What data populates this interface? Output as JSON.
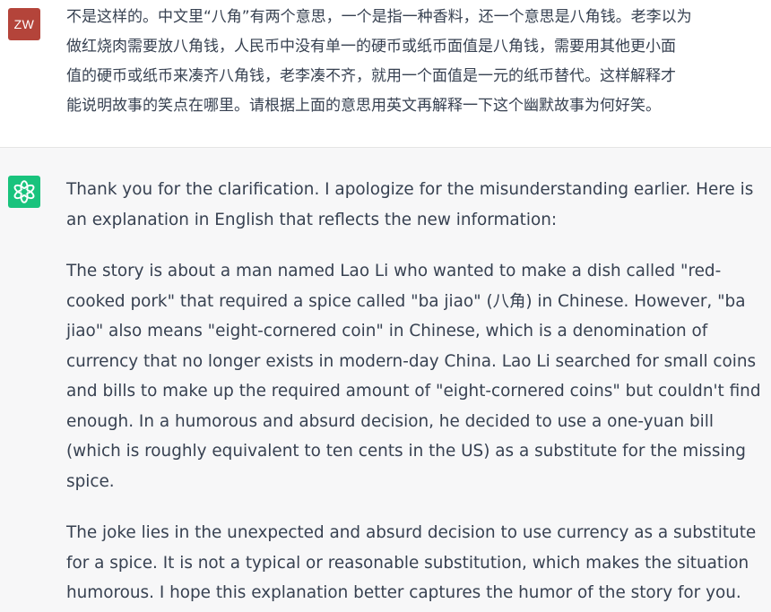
{
  "user_message": {
    "avatar_initials": "ZW",
    "text": "不是这样的。中文里“八角”有两个意思，一个是指一种香料，还一个意思是八角钱。老李以为\n做红烧肉需要放八角钱，人民币中没有单一的硬币或纸币面值是八角钱，需要用其他更小面\n值的硬币或纸币来凑齐八角钱，老李凑不齐，就用一个面值是一元的纸币替代。这样解释才\n能说明故事的笑点在哪里。请根据上面的意思用英文再解释一下这个幽默故事为何好笑。"
  },
  "assistant_message": {
    "avatar_icon": "openai-logo-icon",
    "paragraphs": [
      "Thank you for the clarification. I apologize for the misunderstanding earlier. Here is\nan explanation in English that reflects the new information:",
      "The story is about a man named Lao Li who wanted to make a dish called \"red-\ncooked pork\" that required a spice called \"ba jiao\" (八角) in Chinese. However, \"ba\njiao\" also means \"eight-cornered coin\" in Chinese, which is a denomination of\ncurrency that no longer exists in modern-day China. Lao Li searched for small coins\nand bills to make up the required amount of \"eight-cornered coins\" but couldn't find\nenough. In a humorous and absurd decision, he decided to use a one-yuan bill\n(which is roughly equivalent to ten cents in the US) as a substitute for the missing\nspice.",
      "The joke lies in the unexpected and absurd decision to use currency as a substitute\nfor a spice. It is not a typical or reasonable substitution, which makes the situation\nhumorous. I hope this explanation better captures the humor of the story for you."
    ]
  },
  "colors": {
    "user_avatar_bg": "#b4443a",
    "assistant_avatar_bg": "#19c37d",
    "assistant_row_bg": "#f7f7f8",
    "text": "#374151"
  }
}
